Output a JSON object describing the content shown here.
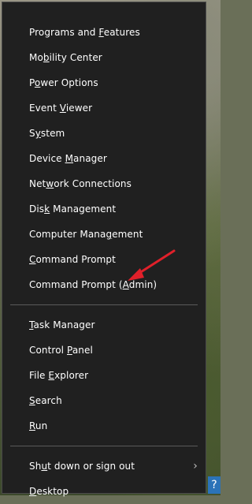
{
  "menu": {
    "group1": [
      {
        "pre": "Programs and ",
        "u": "F",
        "post": "eatures"
      },
      {
        "pre": "Mo",
        "u": "b",
        "post": "ility Center"
      },
      {
        "pre": "P",
        "u": "o",
        "post": "wer Options"
      },
      {
        "pre": "Event ",
        "u": "V",
        "post": "iewer"
      },
      {
        "pre": "S",
        "u": "y",
        "post": "stem"
      },
      {
        "pre": "Device ",
        "u": "M",
        "post": "anager"
      },
      {
        "pre": "Net",
        "u": "w",
        "post": "ork Connections"
      },
      {
        "pre": "Dis",
        "u": "k",
        "post": " Management"
      },
      {
        "pre": "Computer Mana",
        "u": "g",
        "post": "ement"
      },
      {
        "pre": "",
        "u": "C",
        "post": "ommand Prompt"
      },
      {
        "pre": "Command Prompt (",
        "u": "A",
        "post": "dmin)"
      }
    ],
    "group2": [
      {
        "pre": "",
        "u": "T",
        "post": "ask Manager"
      },
      {
        "pre": "Control ",
        "u": "P",
        "post": "anel"
      },
      {
        "pre": "File ",
        "u": "E",
        "post": "xplorer"
      },
      {
        "pre": "",
        "u": "S",
        "post": "earch"
      },
      {
        "pre": "",
        "u": "R",
        "post": "un"
      }
    ],
    "group3": [
      {
        "pre": "Sh",
        "u": "u",
        "post": "t down or sign out",
        "submenu": true
      },
      {
        "pre": "",
        "u": "D",
        "post": "esktop"
      }
    ]
  },
  "help_badge": "?",
  "colors": {
    "menu_bg": "#202020",
    "text": "#ffffff",
    "separator": "#5a5a5a",
    "annotation_arrow": "#e0202a"
  }
}
